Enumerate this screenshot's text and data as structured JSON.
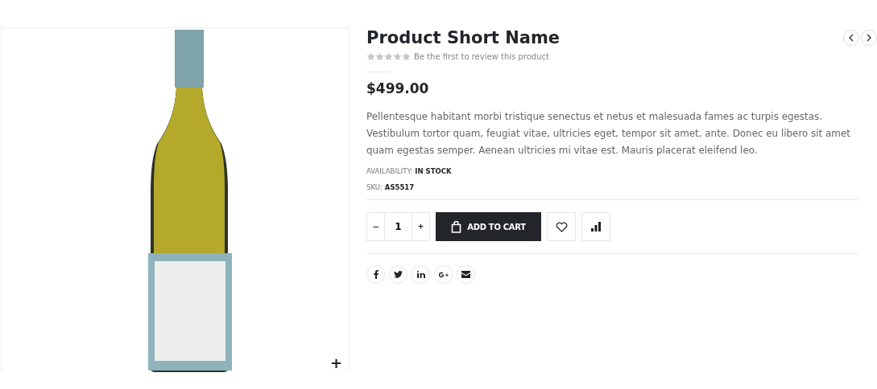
{
  "product": {
    "title": "Product Short Name",
    "stars": 0,
    "review_link": "Be the first to review this product",
    "price": "$499.00",
    "description": "Pellentesque habitant morbi tristique senectus et netus et malesuada fames ac turpis egestas. Vestibulum tortor quam, feugiat vitae, ultricies eget, tempor sit amet, ante. Donec eu libero sit amet quam egestas semper. Aenean ultricies mi vitae est. Mauris placerat eleifend leo.",
    "meta": [
      {
        "label": "AVAILABILITY:",
        "value": "IN STOCK"
      },
      {
        "label": "SKU:",
        "value": "AS5517"
      }
    ]
  },
  "cart": {
    "decrease": "–",
    "quantity": "1",
    "increase": "+",
    "add_button": "ADD TO CART"
  },
  "gallery": {
    "zoom": "+"
  },
  "share": [
    {
      "kind": "facebook"
    },
    {
      "kind": "twitter"
    },
    {
      "kind": "linkedin"
    },
    {
      "kind": "google"
    },
    {
      "kind": "email"
    }
  ]
}
